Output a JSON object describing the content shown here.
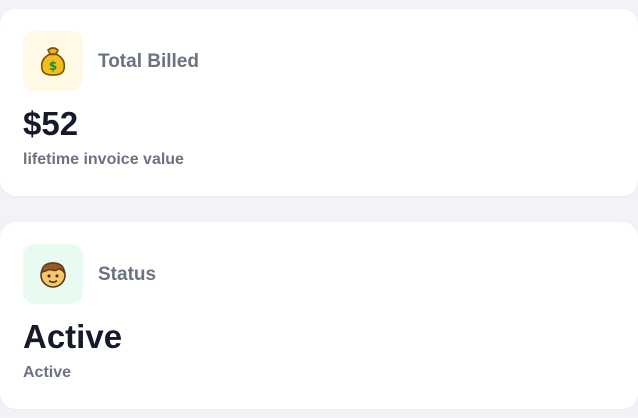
{
  "cards": [
    {
      "icon": "money-bag-icon",
      "icon_bg": "#fff9e6",
      "title": "Total Billed",
      "value": "$52",
      "subtitle": "lifetime invoice value"
    },
    {
      "icon": "person-icon",
      "icon_bg": "#e9fbf1",
      "title": "Status",
      "value": "Active",
      "subtitle": "Active"
    }
  ],
  "colors": {
    "page_bg": "#f2f3f6",
    "card_bg": "#ffffff",
    "title_text": "#6b7280",
    "value_text": "#151a2b"
  }
}
